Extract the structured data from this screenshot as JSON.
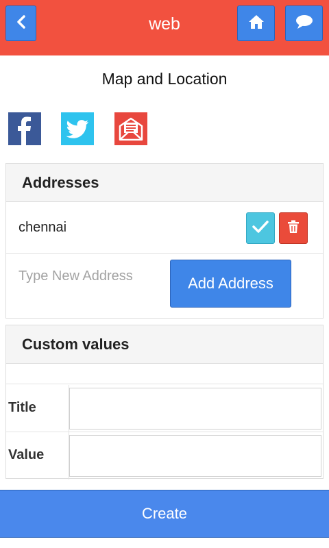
{
  "header": {
    "title": "web",
    "back_icon": "chevron-left-icon",
    "home_icon": "home-icon",
    "chat_icon": "chat-bubble-icon",
    "bar_color": "#f2513f",
    "button_color": "#3f86e8"
  },
  "page": {
    "title": "Map and Location"
  },
  "social": {
    "icons": [
      "facebook-icon",
      "twitter-icon",
      "email-icon"
    ]
  },
  "addresses": {
    "heading": "Addresses",
    "items": [
      {
        "label": "chennai"
      }
    ],
    "new_address_placeholder": "Type New Address",
    "add_button_label": "Add Address"
  },
  "custom_values": {
    "heading": "Custom values",
    "title_label": "Title",
    "title_value": "",
    "value_label": "Value",
    "value_value": ""
  },
  "footer": {
    "create_label": "Create"
  }
}
